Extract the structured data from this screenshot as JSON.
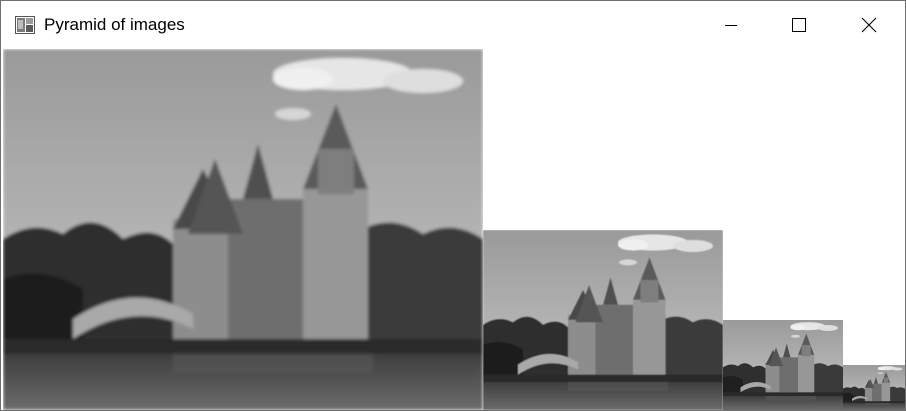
{
  "window": {
    "title": "Pyramid of images",
    "icon": "app-image-icon",
    "controls": [
      {
        "name": "minimize",
        "icon": "minimize-icon"
      },
      {
        "name": "maximize",
        "icon": "maximize-icon"
      },
      {
        "name": "close",
        "icon": "close-icon"
      }
    ]
  },
  "content": {
    "description_levels": [
      "level-0",
      "level-1",
      "level-2",
      "level-3"
    ]
  },
  "colors": {
    "titlebar_bg": "#ffffff",
    "border": "#6f6f6f",
    "image_tone": "grayscale"
  }
}
